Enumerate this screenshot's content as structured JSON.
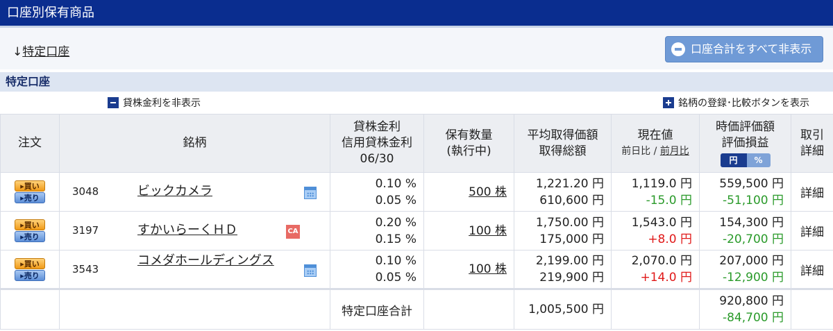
{
  "page": {
    "title": "口座別保有商品"
  },
  "nav": {
    "anchor_arrow": "↓",
    "anchor_link": "特定口座"
  },
  "toolbar": {
    "hide_all_button": "口座合計をすべて非表示"
  },
  "section": {
    "title": "特定口座",
    "hide_lending_rate": "貸株金利を非表示",
    "show_compare": "銘柄の登録･比較ボタンを表示"
  },
  "columns": {
    "order": "注文",
    "stock": "銘柄",
    "rate_line1": "貸株金利",
    "rate_line2": "信用貸株金利",
    "rate_line3": "06/30",
    "qty_line1": "保有数量",
    "qty_line2": "(執行中)",
    "avg_line1": "平均取得価額",
    "avg_line2": "取得総額",
    "price_line1": "現在値",
    "price_prev_day": "前日比",
    "price_sep": " / ",
    "price_prev_month": "前月比",
    "value_line1": "時価評価額",
    "value_line2": "評価損益",
    "toggle_yen": "円",
    "toggle_pct": "%",
    "detail_line1": "取引",
    "detail_line2": "詳細"
  },
  "buttons": {
    "buy": "▸買い",
    "sell": "▸売り"
  },
  "rows": [
    {
      "code": "3048",
      "name": "ビックカメラ",
      "icon": "calendar-icon",
      "rate1": "0.10 %",
      "rate2": "0.05 %",
      "qty": "500 株",
      "avg_price": "1,221.20 円",
      "total_cost": "610,600 円",
      "price": "1,119.0 円",
      "change": "-15.0 円",
      "value": "559,500 円",
      "pl": "-51,100 円",
      "detail": "詳細"
    },
    {
      "code": "3197",
      "name": "すかいらーくＨＤ",
      "icon": "ca-icon",
      "rate1": "0.20 %",
      "rate2": "0.15 %",
      "qty": "100 株",
      "avg_price": "1,750.00 円",
      "total_cost": "175,000 円",
      "price": "1,543.0 円",
      "change": "+8.0 円",
      "value": "154,300 円",
      "pl": "-20,700 円",
      "detail": "詳細"
    },
    {
      "code": "3543",
      "name": "コメダホールディングス",
      "icon": "calendar-icon",
      "rate1": "0.10 %",
      "rate2": "0.05 %",
      "qty": "100 株",
      "avg_price": "2,199.00 円",
      "total_cost": "219,900 円",
      "price": "2,070.0 円",
      "change": "+14.0 円",
      "value": "207,000 円",
      "pl": "-12,900 円",
      "detail": "詳細"
    }
  ],
  "total": {
    "label": "特定口座合計",
    "cost": "1,005,500 円",
    "value": "920,800 円",
    "pl": "-84,700 円"
  },
  "colors": {
    "header_bg": "#0a2d8f",
    "gain": "#e01818",
    "loss": "#2a9a2a"
  }
}
